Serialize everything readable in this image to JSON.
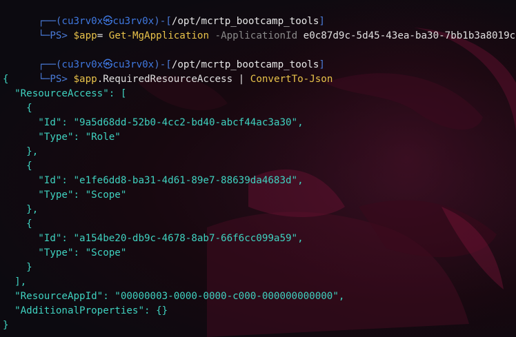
{
  "prompt": {
    "frame_top": "┌──(",
    "user": "cu3rv0x",
    "skull": "㉿",
    "host": "cu3rv0x",
    "frame_mid": ")-[",
    "path": "/opt/mcrtp_bootcamp_tools",
    "frame_end": "]",
    "frame_bottom": "└─",
    "ps": "PS> "
  },
  "commands": [
    {
      "var": "$app",
      "op": "= ",
      "cmdlet": "Get-MgApplication",
      "param": " -ApplicationId",
      "value": " e0c87d9c-5d45-43ea-ba30-7bb1b3a8019c"
    },
    {
      "var": "$app",
      "member": ".RequiredResourceAccess | ",
      "cmdlet": "ConvertTo-Json"
    }
  ],
  "output_lines": [
    "{",
    "  \"ResourceAccess\": [",
    "    {",
    "      \"Id\": \"9a5d68dd-52b0-4cc2-bd40-abcf44ac3a30\",",
    "      \"Type\": \"Role\"",
    "    },",
    "    {",
    "      \"Id\": \"e1fe6dd8-ba31-4d61-89e7-88639da4683d\",",
    "      \"Type\": \"Scope\"",
    "    },",
    "    {",
    "      \"Id\": \"a154be20-db9c-4678-8ab7-66f6cc099a59\",",
    "      \"Type\": \"Scope\"",
    "    }",
    "  ],",
    "  \"ResourceAppId\": \"00000003-0000-0000-c000-000000000000\",",
    "  \"AdditionalProperties\": {}",
    "}"
  ],
  "colors": {
    "background": "#0e0a12",
    "prompt_frame": "#4a7cd9",
    "command_yellow": "#e8c24a",
    "parameter_gray": "#8a8a8a",
    "json_cyan": "#3fd2c0",
    "wallpaper_accent": "#b0104a"
  }
}
